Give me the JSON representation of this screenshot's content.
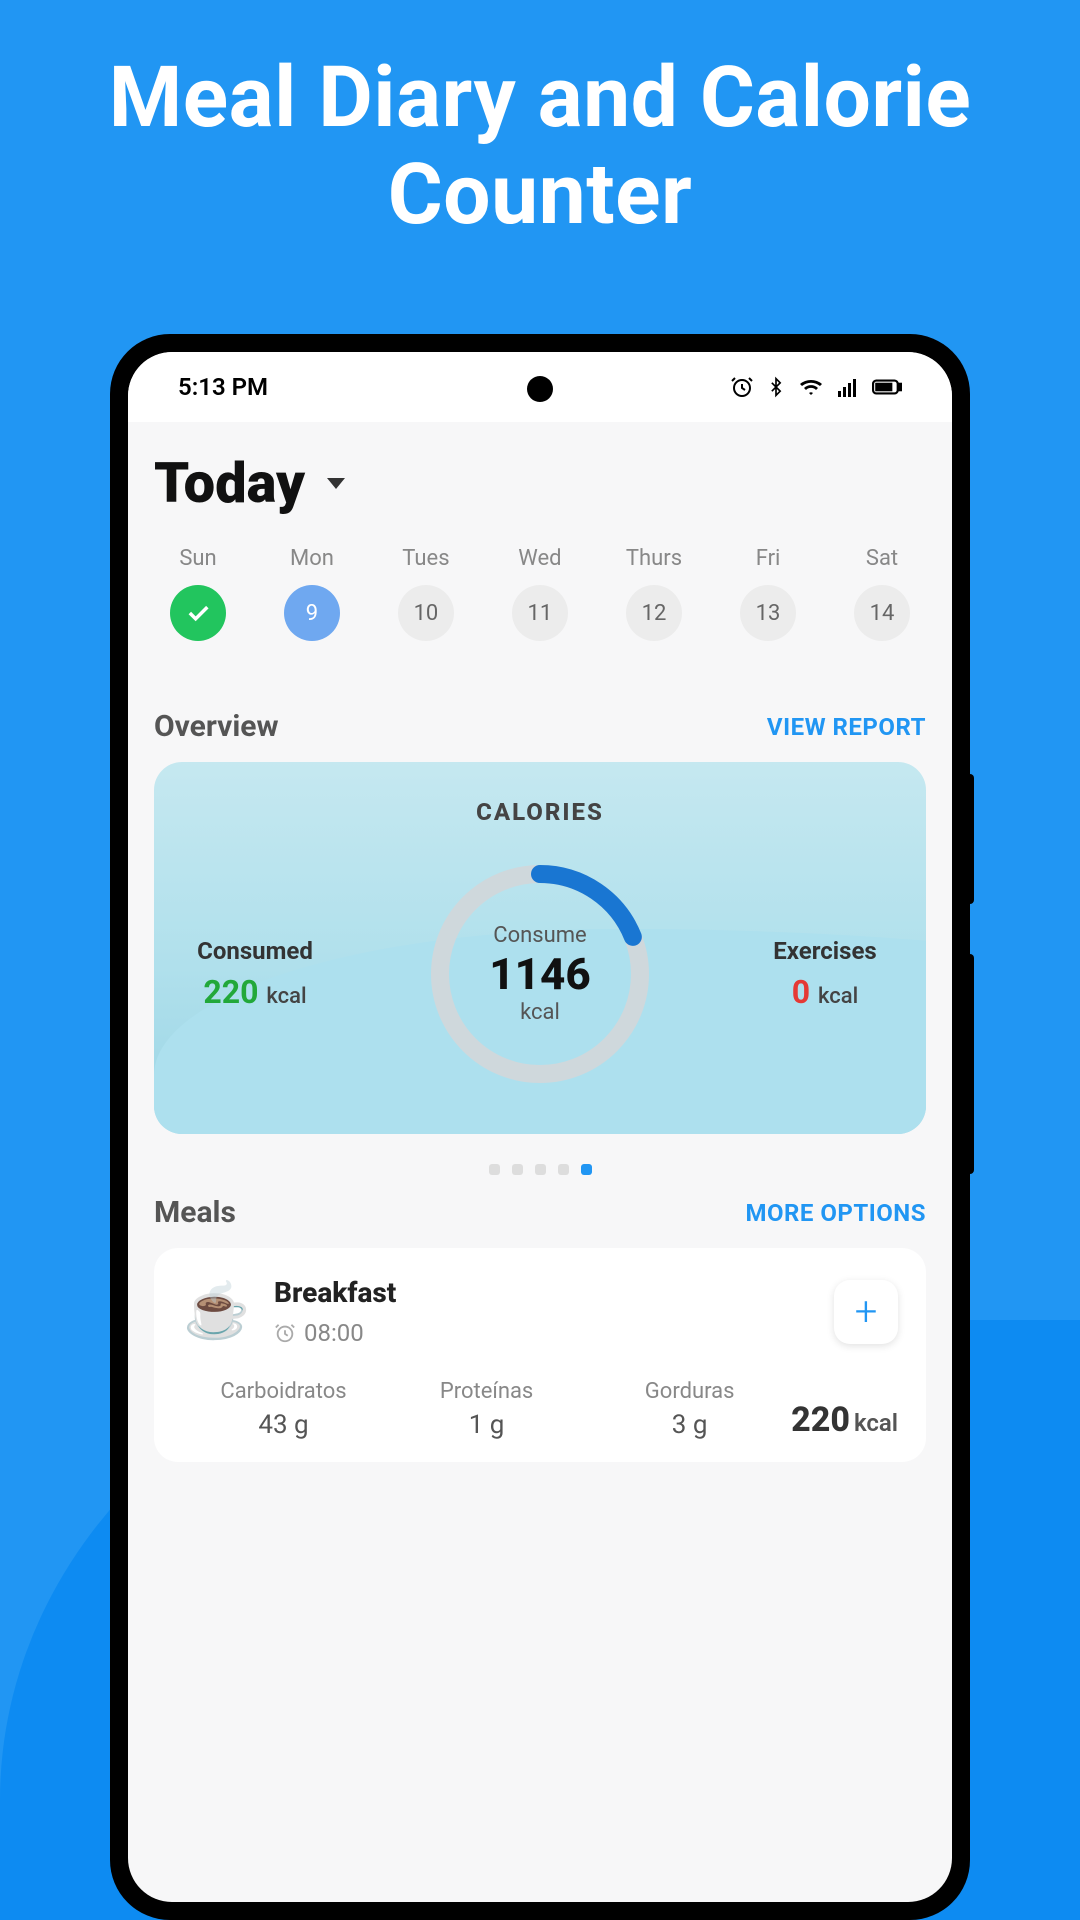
{
  "hero": {
    "title": "Meal Diary and Calorie Counter"
  },
  "status": {
    "time": "5:13 PM"
  },
  "header": {
    "title": "Today"
  },
  "calendar": {
    "days": [
      {
        "label": "Sun",
        "value": "",
        "state": "done"
      },
      {
        "label": "Mon",
        "value": "9",
        "state": "selected"
      },
      {
        "label": "Tues",
        "value": "10",
        "state": ""
      },
      {
        "label": "Wed",
        "value": "11",
        "state": ""
      },
      {
        "label": "Thurs",
        "value": "12",
        "state": ""
      },
      {
        "label": "Fri",
        "value": "13",
        "state": ""
      },
      {
        "label": "Sat",
        "value": "14",
        "state": ""
      }
    ]
  },
  "overview": {
    "title": "Overview",
    "link": "VIEW REPORT",
    "card": {
      "title": "CALORIES",
      "consumed_label": "Consumed",
      "consumed_value": "220",
      "consumed_unit": "kcal",
      "consume_label": "Consume",
      "consume_value": "1146",
      "consume_unit": "kcal",
      "exercises_label": "Exercises",
      "exercises_value": "0",
      "exercises_unit": "kcal",
      "progress_percent": 19
    },
    "page_count": 5,
    "active_page_index": 4
  },
  "meals": {
    "title": "Meals",
    "link": "MORE OPTIONS",
    "items": [
      {
        "name": "Breakfast",
        "time": "08:00",
        "icon": "☕",
        "macros": [
          {
            "label": "Carboidratos",
            "value": "43 g"
          },
          {
            "label": "Proteínas",
            "value": "1 g"
          },
          {
            "label": "Gorduras",
            "value": "3 g"
          }
        ],
        "total_value": "220",
        "total_unit": "kcal"
      }
    ]
  }
}
